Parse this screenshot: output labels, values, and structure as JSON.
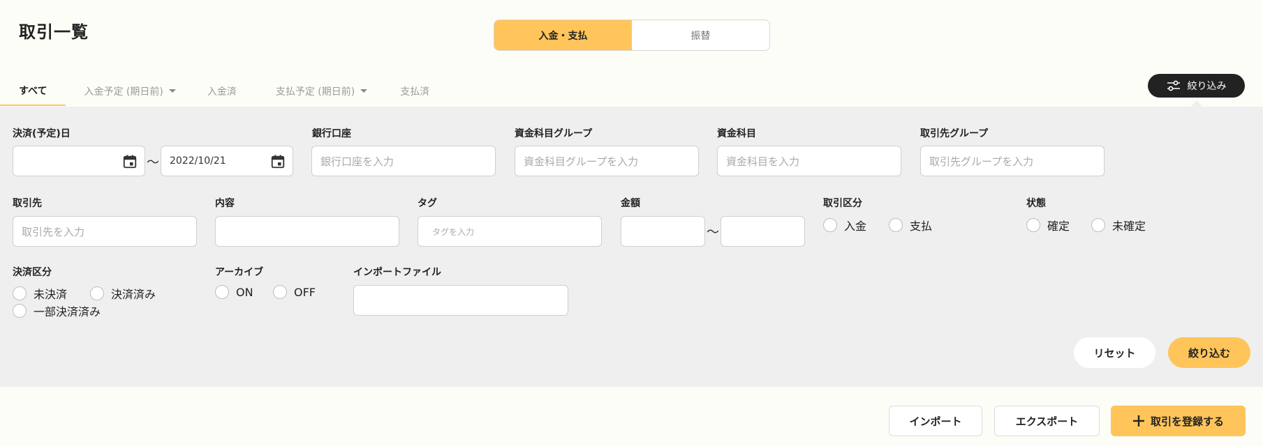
{
  "page": {
    "title": "取引一覧"
  },
  "segment": {
    "options": [
      "入金・支払",
      "振替"
    ],
    "active": "入金・支払"
  },
  "tabs": [
    {
      "label": "すべて",
      "active": true,
      "dropdown": false
    },
    {
      "label": "入金予定 (期日前)",
      "active": false,
      "dropdown": true
    },
    {
      "label": "入金済",
      "active": false,
      "dropdown": false
    },
    {
      "label": "支払予定 (期日前)",
      "active": false,
      "dropdown": true
    },
    {
      "label": "支払済",
      "active": false,
      "dropdown": false
    }
  ],
  "filter_toggle": {
    "label": "絞り込み",
    "icon": "sliders-icon"
  },
  "filters": {
    "settlement_date": {
      "label": "決済(予定)日",
      "from_value": "",
      "to_value": "2022/10/21",
      "separator": "〜"
    },
    "bank_account": {
      "label": "銀行口座",
      "placeholder": "銀行口座を入力"
    },
    "account_group": {
      "label": "資金科目グループ",
      "placeholder": "資金科目グループを入力"
    },
    "account_item": {
      "label": "資金科目",
      "placeholder": "資金科目を入力"
    },
    "partner_group": {
      "label": "取引先グループ",
      "placeholder": "取引先グループを入力"
    },
    "partner": {
      "label": "取引先",
      "placeholder": "取引先を入力"
    },
    "content": {
      "label": "内容",
      "value": ""
    },
    "tag": {
      "label": "タグ",
      "placeholder": "タグを入力"
    },
    "amount": {
      "label": "金額",
      "separator": "〜"
    },
    "transaction_type": {
      "label": "取引区分",
      "options": [
        "入金",
        "支払"
      ]
    },
    "status": {
      "label": "状態",
      "options": [
        "確定",
        "未確定"
      ]
    },
    "settlement_type": {
      "label": "決済区分",
      "options": [
        "未決済",
        "決済済み",
        "一部決済済み"
      ]
    },
    "archive": {
      "label": "アーカイブ",
      "options": [
        "ON",
        "OFF"
      ]
    },
    "import_file": {
      "label": "インポートファイル",
      "value": ""
    }
  },
  "actions": {
    "reset": "リセット",
    "apply": "絞り込む"
  },
  "footer": {
    "import": "インポート",
    "export": "エクスポート",
    "register": "取引を登録する"
  },
  "colors": {
    "accent": "#ffc55a",
    "dark": "#222222",
    "panel": "#efefef"
  }
}
